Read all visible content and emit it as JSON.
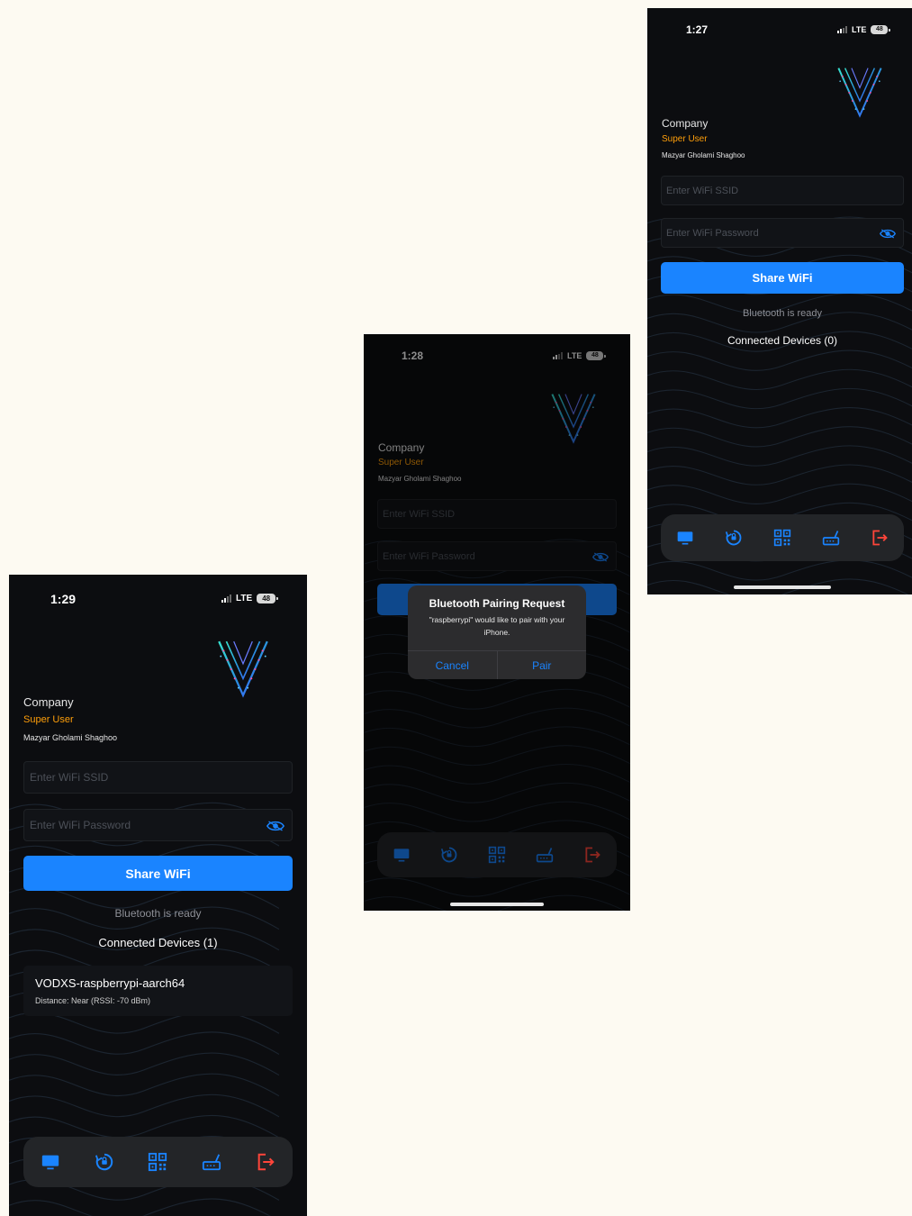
{
  "colors": {
    "page_bg": "#fdfaf2",
    "phone_bg": "#0c0d10",
    "accent": "#1a84ff",
    "role": "#ff9f0a",
    "logout": "#ff453a"
  },
  "icons": [
    "logo-v-icon",
    "eye-icon",
    "monitor-icon",
    "sync-icon",
    "qr-code-icon",
    "router-icon",
    "logout-icon",
    "signal-icon",
    "battery-icon"
  ],
  "screens": [
    {
      "status": {
        "time": "1:29",
        "network": "LTE",
        "battery": "48"
      },
      "company": "Company",
      "role": "Super User",
      "user": "Mazyar Gholami Shaghoo",
      "ssid_placeholder": "Enter WiFi SSID",
      "password_placeholder": "Enter WiFi Password",
      "share_label": "Share WiFi",
      "bt_status": "Bluetooth is ready",
      "connected_title": "Connected Devices (1)",
      "devices": [
        {
          "name": "VODXS-raspberrypi-aarch64",
          "distance": "Distance: Near (RSSI: -70 dBm)"
        }
      ]
    },
    {
      "status": {
        "time": "1:28",
        "network": "LTE",
        "battery": "48"
      },
      "company": "Company",
      "role": "Super User",
      "user": "Mazyar Gholami Shaghoo",
      "ssid_placeholder": "Enter WiFi SSID",
      "password_placeholder": "Enter WiFi Password",
      "dialog": {
        "title": "Bluetooth Pairing Request",
        "message": "\"raspberrypi\" would like to pair with your iPhone.",
        "cancel": "Cancel",
        "confirm": "Pair"
      }
    },
    {
      "status": {
        "time": "1:27",
        "network": "LTE",
        "battery": "48"
      },
      "company": "Company",
      "role": "Super User",
      "user": "Mazyar Gholami Shaghoo",
      "ssid_placeholder": "Enter WiFi SSID",
      "password_placeholder": "Enter WiFi Password",
      "share_label": "Share WiFi",
      "bt_status": "Bluetooth is ready",
      "connected_title": "Connected Devices (0)"
    }
  ]
}
